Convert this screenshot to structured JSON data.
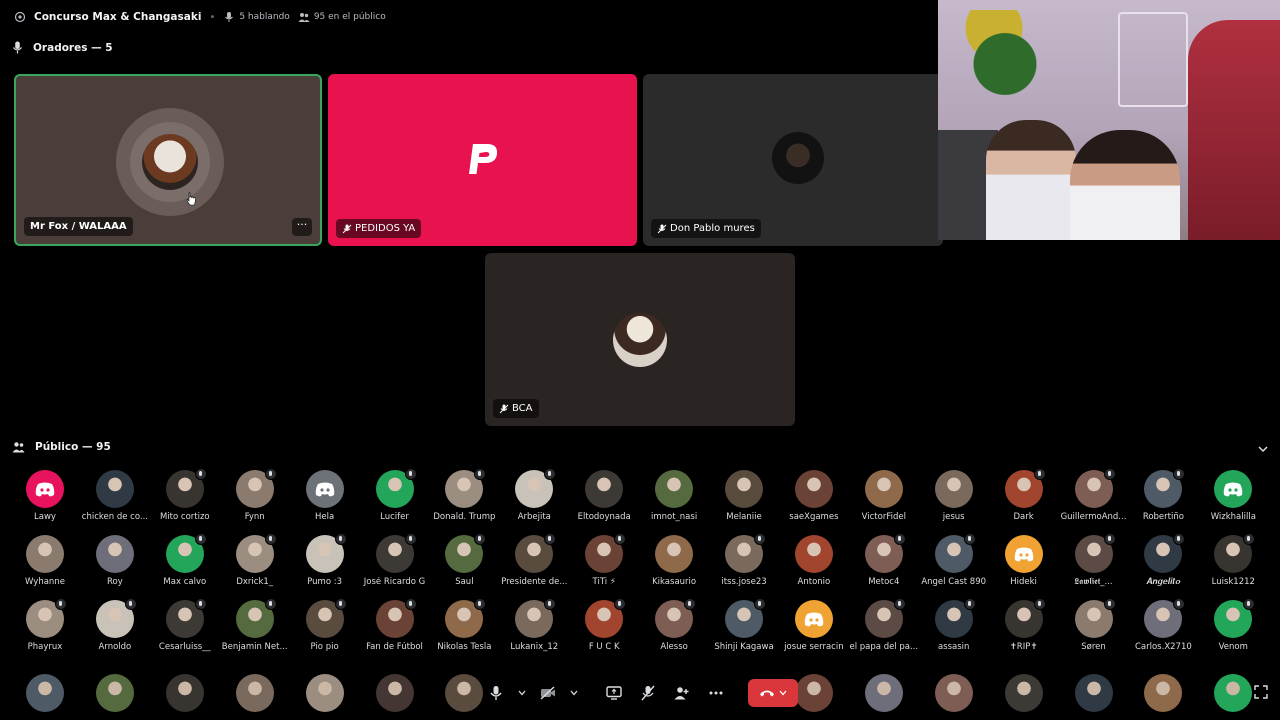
{
  "header": {
    "stage_title": "Concurso Max & Changasaki",
    "speaking_count": "5 hablando",
    "audience_count": "95 en el público"
  },
  "speakers_section": {
    "title": "Oradores — 5"
  },
  "speakers": [
    {
      "name": "Mr Fox / WALAAA",
      "more": "···"
    },
    {
      "name": "PEDIDOS YA"
    },
    {
      "name": "Don Pablo mures"
    },
    {
      "name": "BCA"
    }
  ],
  "audience_section": {
    "title": "Público — 95"
  },
  "audience": [
    [
      "Lawy",
      "chicken de co...",
      "Mito cortizo",
      "Fynn",
      "Hela",
      "Lucifer",
      "Donald. Trump",
      "Arbejita",
      "Eltodoynada",
      "imnot_nasi",
      "Melaniie",
      "saeXgames",
      "VictorFidel",
      "jesus",
      "Dark",
      "GuillermoAnd...",
      "Robertiño",
      "Wizkhalilla"
    ],
    [
      "Wyhanne",
      "Roy",
      "Max calvo",
      "Dxrick1_",
      "Pumo :3",
      "José Ricardo G",
      "Saul",
      "Presidente de...",
      "TiTi ⚡",
      "Kikasaurio",
      "itss.jose23",
      "Antonio",
      "Metoc4",
      "Angel Cast 890",
      "Hideki",
      "𝕷𝖆𝖜𝖑𝖎𝖊𝖙_...",
      "𝑨𝒏𝒈𝒆𝒍𝒊𝒕𝒐",
      "Luisk1212"
    ],
    [
      "Phayrux",
      "Arnoldo",
      "Cesarluiss__",
      "Benjamin Net...",
      "Pio pio",
      "Fan de Fútbol",
      "Nikolas Tesla",
      "Lukanix_12",
      "F U C K",
      "Alesso",
      "Shinji Kagawa",
      "josue serracin",
      "el papa del pa...",
      "assasin",
      "✝RIP✝",
      "Søren",
      "Carlos.X2710",
      "Venom"
    ]
  ],
  "colors": {
    "accent_speaking": "#3ba55d",
    "pedidosya_brand": "#e8124f",
    "leave_button": "#da373c"
  },
  "icons": {
    "stage": "stage-icon",
    "mic": "microphone-icon",
    "audience": "audience-icon",
    "muted": "mic-muted-icon"
  }
}
